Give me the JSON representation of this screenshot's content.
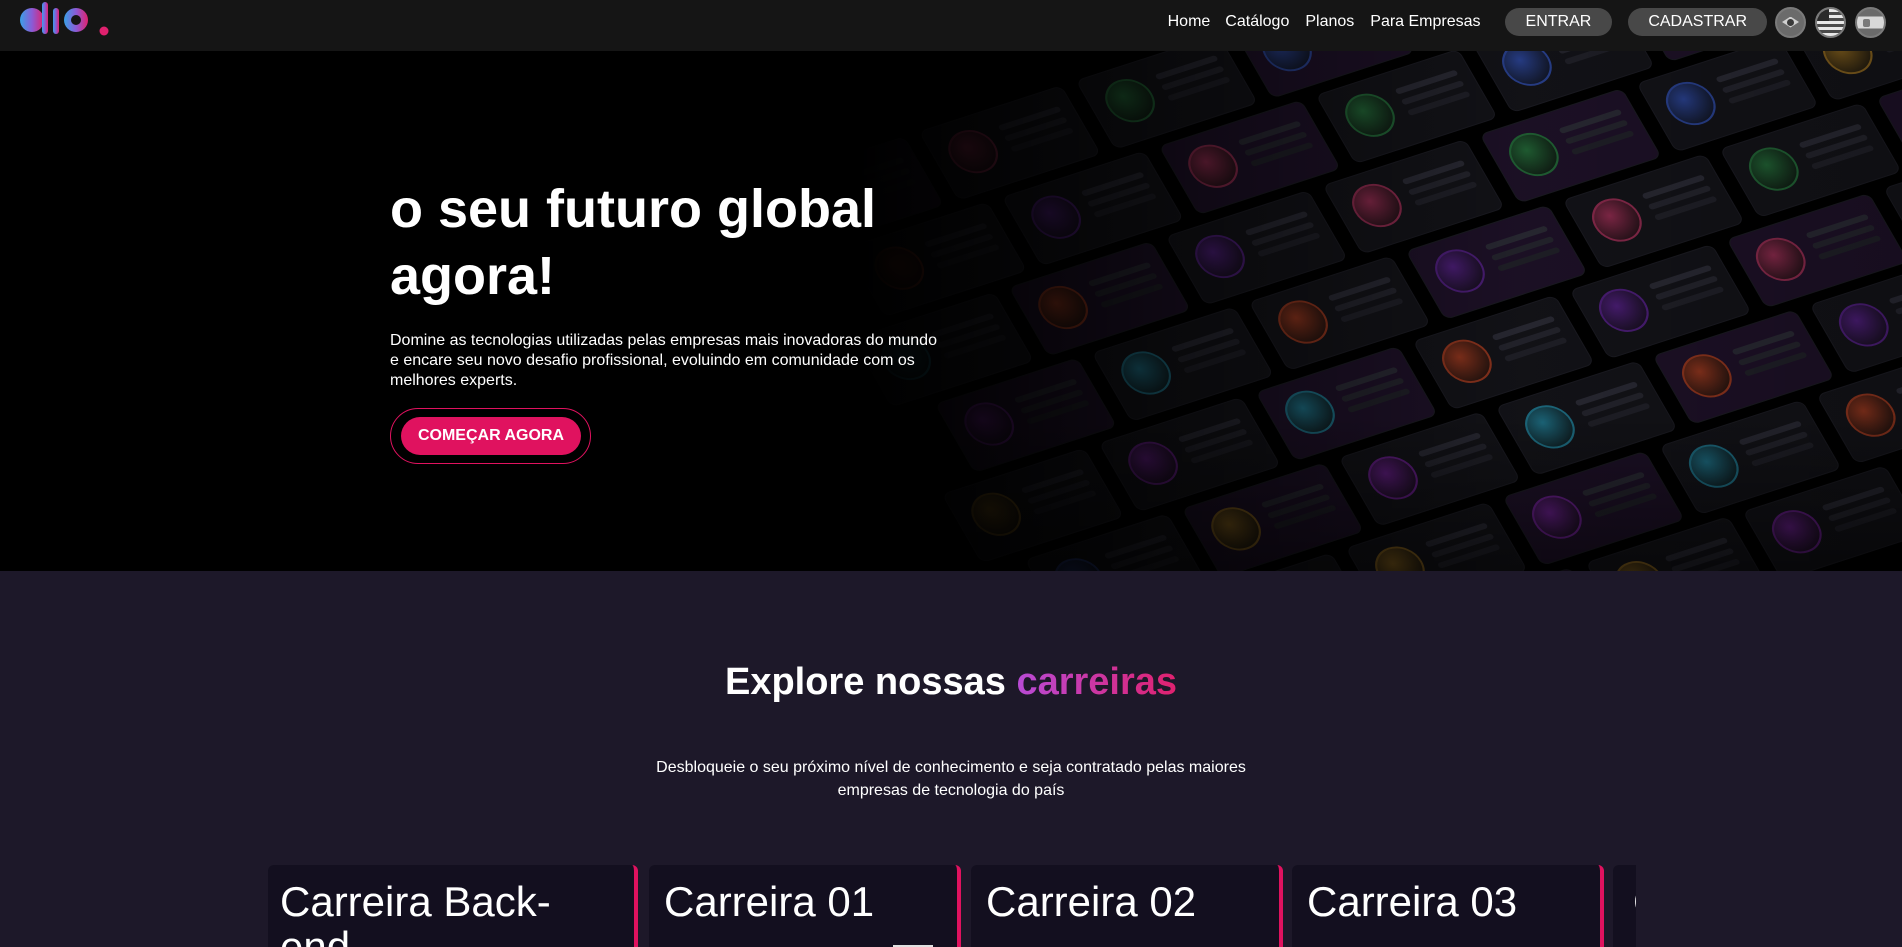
{
  "nav": {
    "links": [
      "Home",
      "Catálogo",
      "Planos",
      "Para Empresas"
    ],
    "entrar": "ENTRAR",
    "cadastrar": "CADASTRAR",
    "languages": [
      "brazil-flag-icon",
      "usa-flag-icon",
      "spain-flag-icon"
    ]
  },
  "hero": {
    "title": "o seu futuro global agora!",
    "text": "Domine as tecnologias utilizadas pelas empresas mais inovadoras do mundo e encare seu novo desafio profissional, evoluindo em comunidade com os melhores experts.",
    "cta": "COMEÇAR AGORA"
  },
  "section": {
    "title_plain": "Explore nossas ",
    "title_accent": "carreiras",
    "subtitle": "Desbloqueie o seu próximo nível de conhecimento e seja contratado pelas maiores empresas de tecnologia do país"
  },
  "cards": [
    {
      "title": "Carreira Back-end"
    },
    {
      "title": "Carreira 01"
    },
    {
      "title": "Carreira 02"
    },
    {
      "title": "Carreira 03"
    },
    {
      "title": "C"
    }
  ],
  "colors": {
    "accent": "#e0125f",
    "accent_gradient_start": "#b84bd6",
    "background": "#1d1829",
    "nav_bg": "#151515",
    "pill_bg": "#484848"
  }
}
